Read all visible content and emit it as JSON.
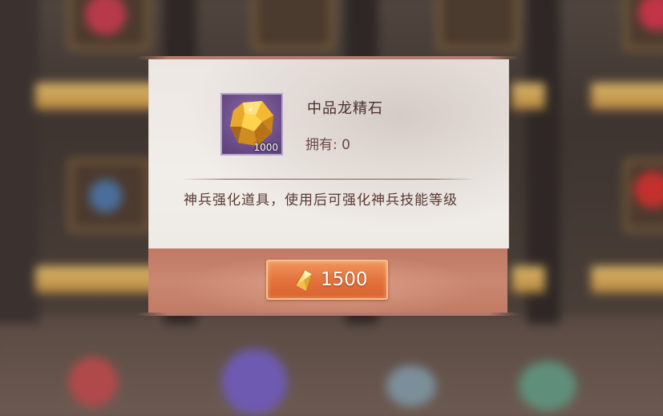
{
  "item": {
    "name": "中品龙精石",
    "icon": "golden-gem-icon",
    "stack_count": "1000",
    "owned_text": "拥有: 0",
    "description": "神兵强化道具，使用后可强化神兵技能等级"
  },
  "purchase": {
    "currency_icon": "gold-crystal-icon",
    "price": "1500"
  },
  "colors": {
    "frame_purple": "#6d4f8b",
    "button_orange": "#e4743f",
    "footer_red": "#c07a66",
    "text_brown": "#4a2d2a"
  }
}
